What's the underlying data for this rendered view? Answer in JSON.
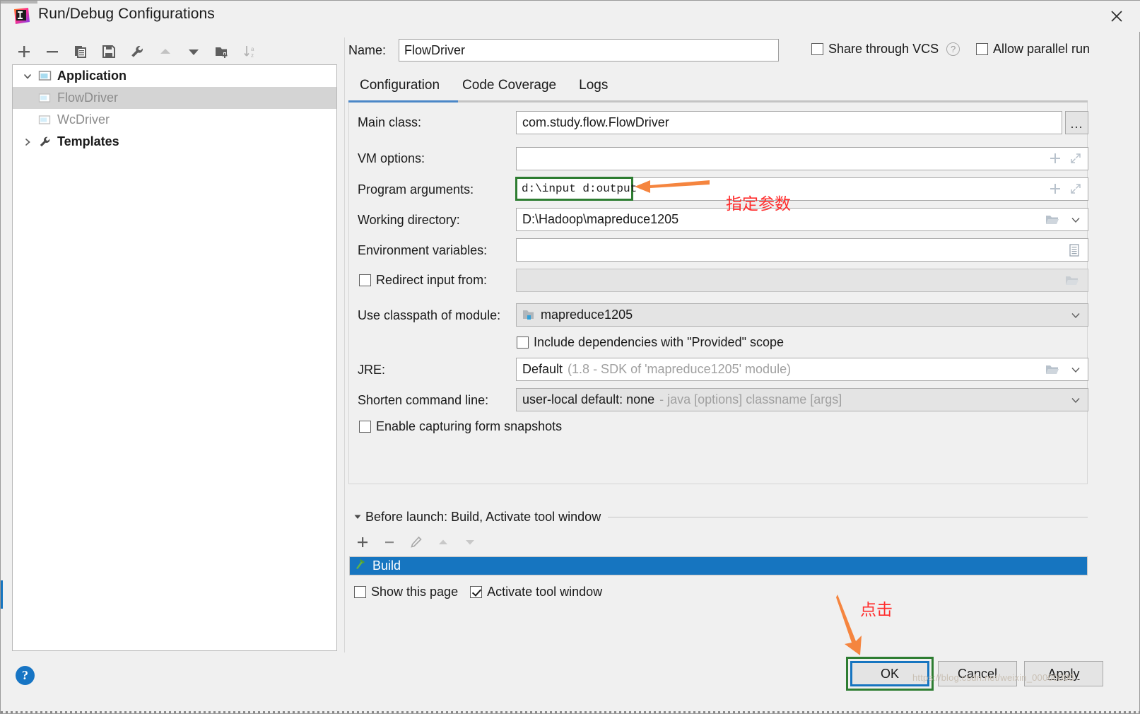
{
  "window": {
    "title": "Run/Debug Configurations",
    "app_icon": "intellij-idea-logo",
    "close_icon": "close-icon"
  },
  "sidebar": {
    "toolbar": [
      {
        "name": "add-button",
        "icon": "plus-icon"
      },
      {
        "name": "remove-button",
        "icon": "minus-icon"
      },
      {
        "name": "copy-button",
        "icon": "copy-icon"
      },
      {
        "name": "save-button",
        "icon": "save-icon"
      },
      {
        "name": "edit-templates-button",
        "icon": "wrench-icon"
      },
      {
        "name": "move-up-button",
        "icon": "arrow-up-icon"
      },
      {
        "name": "move-down-button",
        "icon": "arrow-down-icon"
      },
      {
        "name": "new-folder-button",
        "icon": "folder-add-icon"
      },
      {
        "name": "sort-button",
        "icon": "sort-alpha-icon"
      }
    ],
    "tree": [
      {
        "label": "Application",
        "icon": "application-icon",
        "level": 0,
        "expanded": true,
        "selected": false,
        "bold": true
      },
      {
        "label": "FlowDriver",
        "icon": "run-config-icon",
        "level": 1,
        "expanded": null,
        "selected": true,
        "bold": false
      },
      {
        "label": "WcDriver",
        "icon": "run-config-icon",
        "level": 1,
        "expanded": null,
        "selected": false,
        "bold": false
      },
      {
        "label": "Templates",
        "icon": "wrench-icon",
        "level": 0,
        "expanded": false,
        "selected": false,
        "bold": true
      }
    ],
    "help_label": "?"
  },
  "header": {
    "name_label": "Name:",
    "name_value": "FlowDriver",
    "share_vcs_label": "Share through VCS",
    "share_vcs_checked": false,
    "vcs_help_label": "?",
    "allow_parallel_label": "Allow parallel run",
    "allow_parallel_checked": false
  },
  "tabs": [
    {
      "label": "Configuration",
      "active": true
    },
    {
      "label": "Code Coverage",
      "active": false
    },
    {
      "label": "Logs",
      "active": false
    }
  ],
  "form": {
    "main_class_label": "Main class:",
    "main_class_value": "com.study.flow.FlowDriver",
    "main_class_browse_label": "...",
    "vm_options_label": "VM options:",
    "vm_options_value": "",
    "program_arguments_label": "Program arguments:",
    "program_arguments_value": "d:\\input d:output",
    "working_directory_label": "Working directory:",
    "working_directory_value": "D:\\Hadoop\\mapreduce1205",
    "environment_variables_label": "Environment variables:",
    "environment_variables_value": "",
    "redirect_input_label": "Redirect input from:",
    "redirect_input_checked": false,
    "redirect_input_value": "",
    "use_classpath_label": "Use classpath of module:",
    "use_classpath_value": "mapreduce1205",
    "include_dependencies_label": "Include dependencies with \"Provided\" scope",
    "include_dependencies_checked": false,
    "jre_label": "JRE:",
    "jre_value": "Default",
    "jre_value_dim": "(1.8 - SDK of 'mapreduce1205' module)",
    "shorten_command_label": "Shorten command line:",
    "shorten_command_value": "user-local default: none",
    "shorten_command_dim": "- java [options] classname [args]",
    "enable_snapshots_label": "Enable capturing form snapshots",
    "enable_snapshots_checked": false
  },
  "before_launch": {
    "title": "Before launch: Build, Activate tool window",
    "toolbar": [
      {
        "name": "bl-add-button",
        "icon": "plus-icon"
      },
      {
        "name": "bl-remove-button",
        "icon": "minus-icon"
      },
      {
        "name": "bl-edit-button",
        "icon": "pencil-icon"
      },
      {
        "name": "bl-up-button",
        "icon": "arrow-up-icon"
      },
      {
        "name": "bl-down-button",
        "icon": "arrow-down-icon"
      }
    ],
    "items": [
      {
        "label": "Build",
        "icon": "hammer-icon",
        "selected": true
      }
    ],
    "show_this_page_label": "Show this page",
    "show_this_page_checked": false,
    "activate_tool_window_label": "Activate tool window",
    "activate_tool_window_checked": true
  },
  "buttons": {
    "ok_label": "OK",
    "cancel_label": "Cancel",
    "apply_label": "Apply"
  },
  "annotations": {
    "program_arguments_note": "指定参数",
    "click_note": "点击",
    "watermark": "https://blog.csdn.net/weixin_00000000"
  },
  "colors": {
    "highlight_green": "#2e7d32",
    "annotation_red": "#ff2d2d",
    "annotation_orange": "#f5853f",
    "accent_blue": "#1675c0",
    "tab_underline_blue": "#4b87c7",
    "panel_bg": "#f0f0f0"
  }
}
